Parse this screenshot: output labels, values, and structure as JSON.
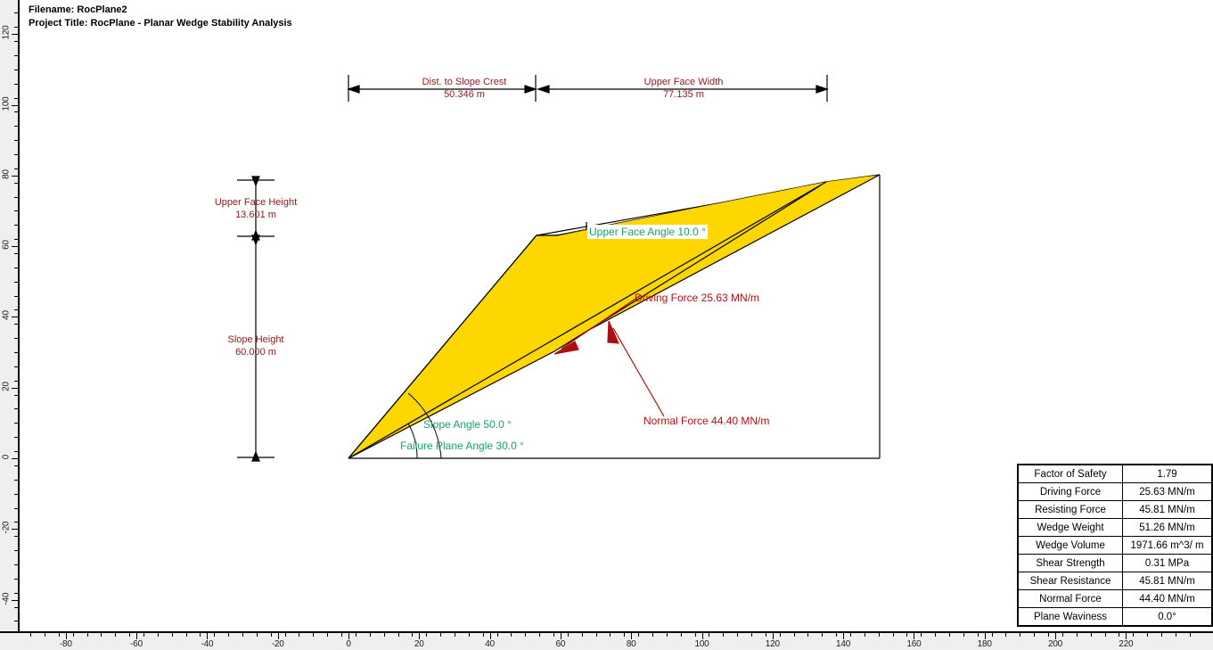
{
  "header": {
    "filename_line": "Filename: RocPlane2",
    "project_line": "Project Title: RocPlane - Planar Wedge Stability Analysis"
  },
  "dimensions": {
    "dist_to_slope_crest": {
      "label": "Dist. to Slope Crest",
      "value": "50.346  m"
    },
    "upper_face_width": {
      "label": "Upper Face Width",
      "value": "77.135  m"
    },
    "upper_face_height": {
      "label": "Upper Face Height",
      "value": "13.601  m"
    },
    "slope_height": {
      "label": "Slope Height",
      "value": "60.000  m"
    }
  },
  "angles": {
    "upper_face_angle": "Upper Face Angle 10.0 °",
    "slope_angle": "Slope Angle 50.0 °",
    "failure_plane_angle": "Failure Plane Angle 30.0 °"
  },
  "forces": {
    "driving": "Driving Force 25.63 MN/m",
    "normal": "Normal Force 44.40 MN/m"
  },
  "results_table": {
    "rows": [
      {
        "name": "Factor of Safety",
        "value": "1.79"
      },
      {
        "name": "Driving Force",
        "value": "25.63 MN/m"
      },
      {
        "name": "Resisting Force",
        "value": "45.81 MN/m"
      },
      {
        "name": "Wedge Weight",
        "value": "51.26 MN/m"
      },
      {
        "name": "Wedge Volume",
        "value": "1971.66 m^3/ m"
      },
      {
        "name": "Shear Strength",
        "value": "0.31 MPa"
      },
      {
        "name": "Shear Resistance",
        "value": "45.81 MN/m"
      },
      {
        "name": "Normal Force",
        "value": "44.40 MN/m"
      },
      {
        "name": "Plane Waviness",
        "value": "0.0°"
      }
    ]
  },
  "axes": {
    "x_labels": [
      "-80",
      "-60",
      "-40",
      "-20",
      "0",
      "20",
      "40",
      "60",
      "80",
      "100",
      "120",
      "140",
      "160",
      "180",
      "200",
      "220"
    ],
    "y_labels": [
      "120",
      "100",
      "80",
      "60",
      "40",
      "20",
      "0",
      "-20",
      "-40"
    ]
  },
  "colors": {
    "wedge_fill": "#FFD700",
    "dimension_text": "#8B1A1A",
    "angle_text": "#17A06A",
    "force_text": "#AA1111",
    "outline": "#000000",
    "ruler_bg": "#EFEFEF"
  }
}
